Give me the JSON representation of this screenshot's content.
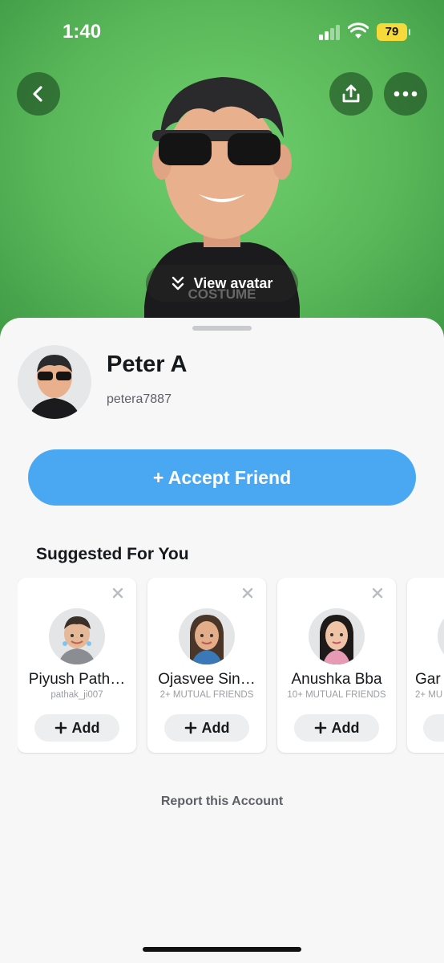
{
  "status_bar": {
    "time": "1:40",
    "battery": "79"
  },
  "hero": {
    "view_avatar_label": "View avatar",
    "shirt_text": "COSTUME"
  },
  "profile": {
    "name": "Peter A",
    "username": "petera7887"
  },
  "actions": {
    "accept_friend": "+ Accept Friend"
  },
  "suggested": {
    "title": "Suggested For You",
    "cards": [
      {
        "name": "Piyush Path…",
        "sub": "pathak_ji007",
        "add": "Add"
      },
      {
        "name": "Ojasvee Sin…",
        "sub": "2+ MUTUAL FRIENDS",
        "add": "Add"
      },
      {
        "name": "Anushka Bba",
        "sub": "10+ MUTUAL FRIENDS",
        "add": "Add"
      },
      {
        "name": "Gar",
        "sub": "2+ MU",
        "add": ""
      }
    ]
  },
  "footer": {
    "report": "Report this Account"
  },
  "colors": {
    "accent": "#4aa8f3",
    "hero_green": "#5ab85a",
    "battery": "#f6d93b"
  },
  "icons": [
    "back-chevron-icon",
    "share-icon",
    "more-dots-icon",
    "chevron-double-down-icon",
    "close-icon",
    "plus-icon"
  ]
}
